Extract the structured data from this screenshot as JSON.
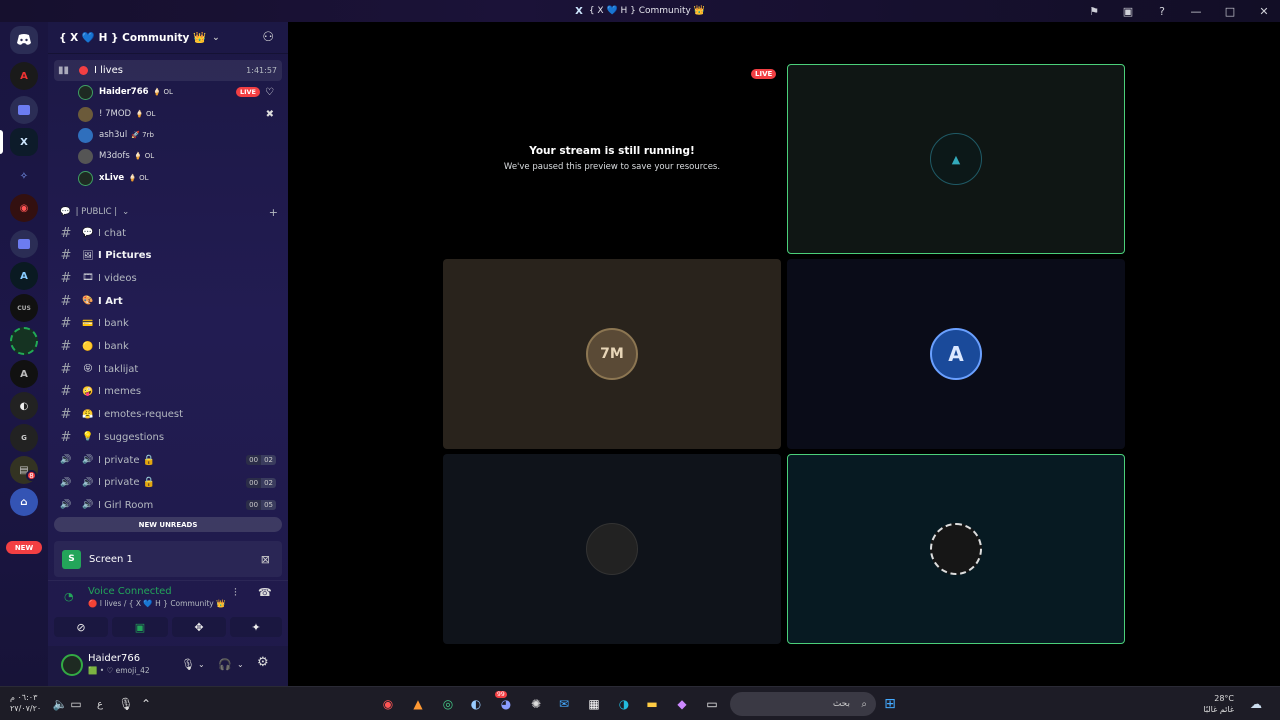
{
  "window": {
    "logo": "X",
    "title": "{ X 💙 H } Community 👑",
    "controls": [
      "⚑",
      "▣",
      "?",
      "—",
      "□",
      "✕"
    ]
  },
  "server": {
    "name": "{ X 💙 H } Community 👑"
  },
  "guild_notifications": {
    "mention_count": "8",
    "new_label": "NEW"
  },
  "voice_channel": {
    "name": "I lives",
    "duration": "1:41:57",
    "live_label": "LIVE",
    "users": [
      {
        "name": "Haider766",
        "tag": "🍦 OL",
        "color": "#3fa063"
      },
      {
        "name": "! 7MOD",
        "tag": "🍦 OL",
        "color": "#6b5a3a"
      },
      {
        "name": "ash3ul",
        "tag": "🚀 7rb",
        "color": "#2f6fbd"
      },
      {
        "name": "M3dofs",
        "tag": "🍦 OL",
        "color": "#555"
      },
      {
        "name": "xLive",
        "tag": "🍦 OL",
        "color": "#3fa063"
      }
    ]
  },
  "category": {
    "label": "| PUBLIC |",
    "icon": "💬"
  },
  "channels": [
    {
      "type": "text",
      "emoji": "💬",
      "name": "I chat",
      "bold": false
    },
    {
      "type": "text",
      "emoji": "🖼",
      "name": "I Pictures",
      "bold": true
    },
    {
      "type": "text",
      "emoji": "🎞",
      "name": "I videos",
      "bold": false
    },
    {
      "type": "text",
      "emoji": "🎨",
      "name": "I Art",
      "bold": true
    },
    {
      "type": "text",
      "emoji": "💳",
      "name": "I bank",
      "bold": false
    },
    {
      "type": "text",
      "emoji": "🟡",
      "name": "I bank",
      "bold": false
    },
    {
      "type": "text",
      "emoji": "😝",
      "name": "I taklijat",
      "bold": false
    },
    {
      "type": "text",
      "emoji": "🤪",
      "name": "I memes",
      "bold": false
    },
    {
      "type": "text",
      "emoji": "😤",
      "name": "I emotes-request",
      "bold": false
    },
    {
      "type": "text",
      "emoji": "💡",
      "name": "I suggestions",
      "bold": false
    },
    {
      "type": "voice",
      "emoji": "🔊",
      "name": "I private 🔒",
      "c1": "00",
      "c2": "02"
    },
    {
      "type": "voice",
      "emoji": "🔊",
      "name": "I private 🔒",
      "c1": "00",
      "c2": "02"
    },
    {
      "type": "voice",
      "emoji": "🔊",
      "name": "I Girl Room",
      "c1": "00",
      "c2": "05"
    }
  ],
  "new_unreads": "NEW UNREADS",
  "screen_share": {
    "label": "Screen 1"
  },
  "voice_status": {
    "title": "Voice Connected",
    "subtitle": "🔴 I lives / { X 💙 H } Community 👑"
  },
  "user_panel": {
    "name": "Haider766",
    "status": "🟩 • ♡ emoji_42"
  },
  "stage": {
    "paused_title": "Your stream is still running!",
    "paused_subtitle": "We've paused this preview to save your resources.",
    "live_label": "LIVE",
    "tile_logo": "7M"
  },
  "taskbar": {
    "search_placeholder": "بحث",
    "clock_time": "٠٦:٠٣ م",
    "clock_date": "٢٧/٠٧/٢٠",
    "lang": "ع",
    "temperature": "28°C",
    "weather_label": "غائم غالبًا",
    "steam_badge": "99"
  },
  "colors": {
    "accent_green": "#23a55a",
    "live_red": "#f23f43",
    "sidebar": "#1f1a4a"
  }
}
